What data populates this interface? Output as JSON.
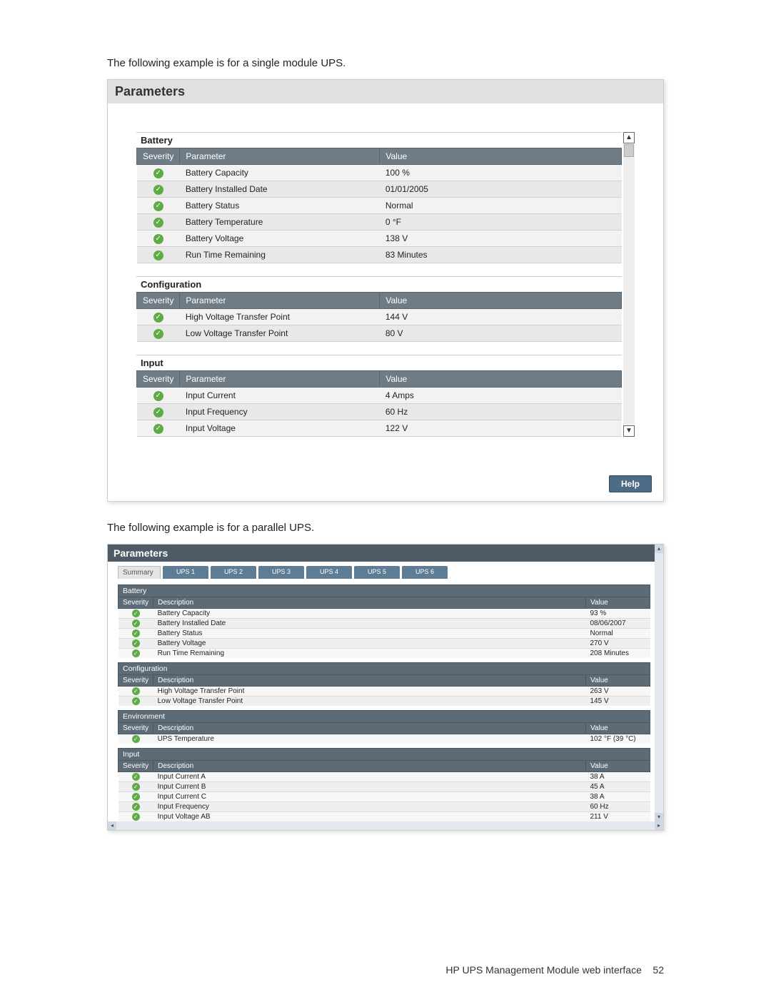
{
  "intro1": "The following example is for a single module UPS.",
  "intro2": "The following example is for a parallel UPS.",
  "footer_text": "HP UPS Management Module web interface",
  "footer_page": "52",
  "panel1": {
    "title": "Parameters",
    "help_label": "Help",
    "columns": {
      "severity": "Severity",
      "parameter": "Parameter",
      "value": "Value"
    },
    "sections": [
      {
        "caption": "Battery",
        "rows": [
          {
            "parameter": "Battery Capacity",
            "value": "100 %"
          },
          {
            "parameter": "Battery Installed Date",
            "value": "01/01/2005"
          },
          {
            "parameter": "Battery Status",
            "value": "Normal"
          },
          {
            "parameter": "Battery Temperature",
            "value": "0 °F"
          },
          {
            "parameter": "Battery Voltage",
            "value": "138 V"
          },
          {
            "parameter": "Run Time Remaining",
            "value": "83 Minutes"
          }
        ]
      },
      {
        "caption": "Configuration",
        "rows": [
          {
            "parameter": "High Voltage Transfer Point",
            "value": "144 V"
          },
          {
            "parameter": "Low Voltage Transfer Point",
            "value": "80 V"
          }
        ]
      },
      {
        "caption": "Input",
        "rows": [
          {
            "parameter": "Input Current",
            "value": "4 Amps"
          },
          {
            "parameter": "Input Frequency",
            "value": "60 Hz"
          },
          {
            "parameter": "Input Voltage",
            "value": "122 V"
          }
        ]
      }
    ]
  },
  "panel2": {
    "title": "Parameters",
    "summary_tab": "Summary",
    "ups_tabs": [
      "UPS 1",
      "UPS 2",
      "UPS 3",
      "UPS 4",
      "UPS 5",
      "UPS 6"
    ],
    "columns": {
      "severity": "Severity",
      "description": "Description",
      "value": "Value"
    },
    "sections": [
      {
        "caption": "Battery",
        "rows": [
          {
            "description": "Battery Capacity",
            "value": "93 %"
          },
          {
            "description": "Battery Installed Date",
            "value": "08/06/2007"
          },
          {
            "description": "Battery Status",
            "value": "Normal"
          },
          {
            "description": "Battery Voltage",
            "value": "270 V"
          },
          {
            "description": "Run Time Remaining",
            "value": "208 Minutes"
          }
        ]
      },
      {
        "caption": "Configuration",
        "rows": [
          {
            "description": "High Voltage Transfer Point",
            "value": "263 V"
          },
          {
            "description": "Low Voltage Transfer Point",
            "value": "145 V"
          }
        ]
      },
      {
        "caption": "Environment",
        "rows": [
          {
            "description": "UPS Temperature",
            "value": "102 °F (39 °C)"
          }
        ]
      },
      {
        "caption": "Input",
        "rows": [
          {
            "description": "Input Current A",
            "value": "38 A"
          },
          {
            "description": "Input Current B",
            "value": "45 A"
          },
          {
            "description": "Input Current C",
            "value": "38 A"
          },
          {
            "description": "Input Frequency",
            "value": "60 Hz"
          },
          {
            "description": "Input Voltage AB",
            "value": "211 V"
          }
        ]
      }
    ]
  }
}
